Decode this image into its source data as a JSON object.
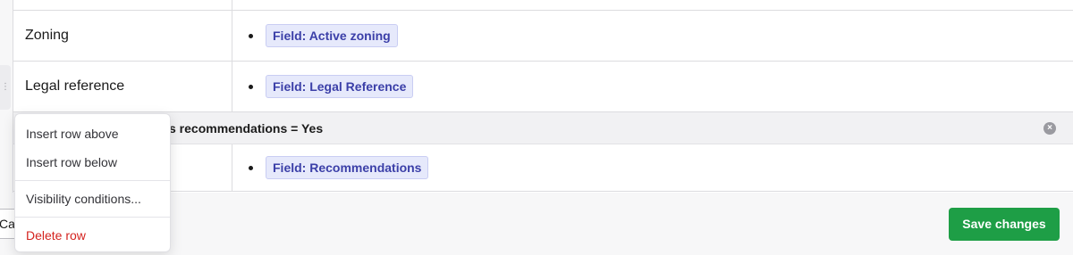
{
  "rows": [
    {
      "label": "Zoning",
      "value": "Field: Active zoning"
    },
    {
      "label": "Legal reference",
      "value": "Field: Legal Reference"
    },
    {
      "label": "",
      "value": "Field: Recommendations"
    }
  ],
  "condition": {
    "text": "s recommendations = Yes"
  },
  "context_menu": {
    "insert_above": "Insert row above",
    "insert_below": "Insert row below",
    "visibility": "Visibility conditions...",
    "delete": "Delete row"
  },
  "footer": {
    "cancel_label": "Cancel",
    "save_label": "Save changes"
  },
  "colors": {
    "save_button": "#1e9e46",
    "chip_bg": "#e6e9fb",
    "chip_text": "#3b3fa8",
    "delete_text": "#d4231f"
  }
}
